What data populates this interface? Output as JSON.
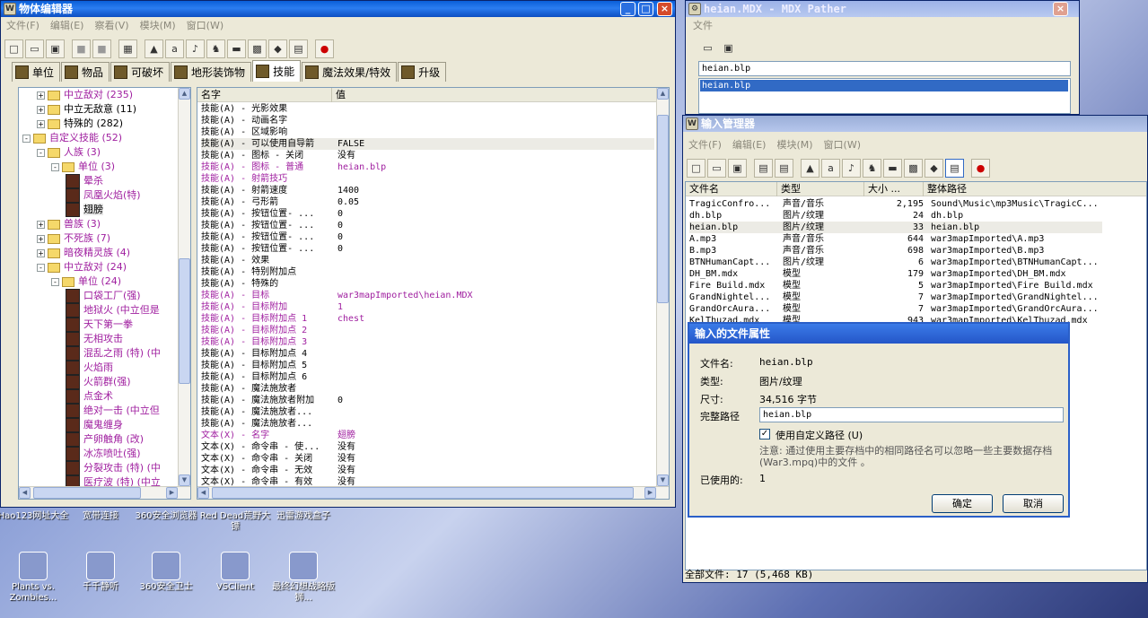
{
  "object_editor": {
    "title": "物体编辑器",
    "menu": [
      "文件(F)",
      "编辑(E)",
      "察看(V)",
      "模块(M)",
      "窗口(W)"
    ],
    "tabs": [
      "单位",
      "物品",
      "可破坏",
      "地形装饰物",
      "技能",
      "魔法效果/特效",
      "升级"
    ],
    "active_tab": "技能",
    "tree": [
      {
        "indent": 0,
        "exp": "+",
        "type": "folder",
        "label": "中立敌对 (235)",
        "purple": true
      },
      {
        "indent": 0,
        "exp": "+",
        "type": "folder",
        "label": "中立无敌意 (11)",
        "purple": false
      },
      {
        "indent": 0,
        "exp": "+",
        "type": "folder",
        "label": "特殊的 (282)",
        "purple": false
      },
      {
        "indent": -1,
        "exp": "-",
        "type": "folder",
        "label": "自定义技能 (52)",
        "purple": true
      },
      {
        "indent": 0,
        "exp": "-",
        "type": "folder",
        "label": "人族 (3)",
        "purple": true
      },
      {
        "indent": 1,
        "exp": "-",
        "type": "folder",
        "label": "单位 (3)",
        "purple": true
      },
      {
        "indent": 2,
        "exp": "",
        "type": "icon",
        "label": "晕杀",
        "purple": true
      },
      {
        "indent": 2,
        "exp": "",
        "type": "icon",
        "label": "凤凰火焰(特)",
        "purple": true
      },
      {
        "indent": 2,
        "exp": "",
        "type": "icon",
        "label": "翅膀",
        "purple": false,
        "selected": true
      },
      {
        "indent": 0,
        "exp": "+",
        "type": "folder",
        "label": "兽族 (3)",
        "purple": true
      },
      {
        "indent": 0,
        "exp": "+",
        "type": "folder",
        "label": "不死族 (7)",
        "purple": true
      },
      {
        "indent": 0,
        "exp": "+",
        "type": "folder",
        "label": "暗夜精灵族 (4)",
        "purple": true
      },
      {
        "indent": 0,
        "exp": "-",
        "type": "folder",
        "label": "中立敌对 (24)",
        "purple": true
      },
      {
        "indent": 1,
        "exp": "-",
        "type": "folder",
        "label": "单位 (24)",
        "purple": true
      },
      {
        "indent": 2,
        "exp": "",
        "type": "icon",
        "label": "口袋工厂(强)",
        "purple": true
      },
      {
        "indent": 2,
        "exp": "",
        "type": "icon",
        "label": "地狱火 (中立但是",
        "purple": true
      },
      {
        "indent": 2,
        "exp": "",
        "type": "icon",
        "label": "天下第一拳",
        "purple": true
      },
      {
        "indent": 2,
        "exp": "",
        "type": "icon",
        "label": "无相攻击",
        "purple": true
      },
      {
        "indent": 2,
        "exp": "",
        "type": "icon",
        "label": "混乱之雨 (特) (中",
        "purple": true
      },
      {
        "indent": 2,
        "exp": "",
        "type": "icon",
        "label": "火焰雨",
        "purple": true
      },
      {
        "indent": 2,
        "exp": "",
        "type": "icon",
        "label": "火箭群(强)",
        "purple": true
      },
      {
        "indent": 2,
        "exp": "",
        "type": "icon",
        "label": "点金术",
        "purple": true
      },
      {
        "indent": 2,
        "exp": "",
        "type": "icon",
        "label": "绝对一击 (中立但",
        "purple": true
      },
      {
        "indent": 2,
        "exp": "",
        "type": "icon",
        "label": "魔鬼缠身",
        "purple": true
      },
      {
        "indent": 2,
        "exp": "",
        "type": "icon",
        "label": "产卵触角 (改)",
        "purple": true
      },
      {
        "indent": 2,
        "exp": "",
        "type": "icon",
        "label": "冰冻喷吐(强)",
        "purple": true
      },
      {
        "indent": 2,
        "exp": "",
        "type": "icon",
        "label": "分裂攻击 (特) (中",
        "purple": true
      },
      {
        "indent": 2,
        "exp": "",
        "type": "icon",
        "label": "医疗波 (特) (中立",
        "purple": true
      }
    ],
    "prop_headers": [
      "名字",
      "值"
    ],
    "props": [
      {
        "name": "技能(A) - 光影效果",
        "value": "",
        "purple": false
      },
      {
        "name": "技能(A) - 动画名字",
        "value": "",
        "purple": false
      },
      {
        "name": "技能(A) - 区域影响",
        "value": "",
        "purple": false
      },
      {
        "name": "技能(A) - 可以使用自导箭",
        "value": "FALSE",
        "purple": false,
        "hl": true
      },
      {
        "name": "技能(A) - 图标 - 关闭",
        "value": "没有",
        "purple": false
      },
      {
        "name": "技能(A) - 图标 - 普通",
        "value": "heian.blp",
        "purple": true
      },
      {
        "name": "技能(A) - 射箭技巧",
        "value": "",
        "purple": true
      },
      {
        "name": "技能(A) - 射箭速度",
        "value": "1400",
        "purple": false
      },
      {
        "name": "技能(A) - 弓形箭",
        "value": "0.05",
        "purple": false
      },
      {
        "name": "技能(A) - 按钮位置- ...",
        "value": "0",
        "purple": false
      },
      {
        "name": "技能(A) - 按钮位置- ...",
        "value": "0",
        "purple": false
      },
      {
        "name": "技能(A) - 按钮位置- ...",
        "value": "0",
        "purple": false
      },
      {
        "name": "技能(A) - 按钮位置- ...",
        "value": "0",
        "purple": false
      },
      {
        "name": "技能(A) - 效果",
        "value": "",
        "purple": false
      },
      {
        "name": "技能(A) - 特别附加点",
        "value": "",
        "purple": false
      },
      {
        "name": "技能(A) - 特殊的",
        "value": "",
        "purple": false
      },
      {
        "name": "技能(A) - 目标",
        "value": "war3mapImported\\heian.MDX",
        "purple": true
      },
      {
        "name": "技能(A) - 目标附加",
        "value": "1",
        "purple": true
      },
      {
        "name": "技能(A) - 目标附加点 1",
        "value": "chest",
        "purple": true
      },
      {
        "name": "技能(A) - 目标附加点 2",
        "value": "",
        "purple": true
      },
      {
        "name": "技能(A) - 目标附加点 3",
        "value": "",
        "purple": true
      },
      {
        "name": "技能(A) - 目标附加点 4",
        "value": "",
        "purple": false
      },
      {
        "name": "技能(A) - 目标附加点 5",
        "value": "",
        "purple": false
      },
      {
        "name": "技能(A) - 目标附加点 6",
        "value": "",
        "purple": false
      },
      {
        "name": "技能(A) - 魔法施放者",
        "value": "",
        "purple": false
      },
      {
        "name": "技能(A) - 魔法施放者附加",
        "value": "0",
        "purple": false
      },
      {
        "name": "技能(A) - 魔法施放者...",
        "value": "",
        "purple": false
      },
      {
        "name": "技能(A) - 魔法施放者...",
        "value": "",
        "purple": false
      },
      {
        "name": "文本(X) - 名字",
        "value": "翅膀",
        "purple": true
      },
      {
        "name": "文本(X) - 命令串 - 使...",
        "value": "没有",
        "purple": false
      },
      {
        "name": "文本(X) - 命令串 - 关闭",
        "value": "没有",
        "purple": false
      },
      {
        "name": "文本(X) - 命令串 - 无效",
        "value": "没有",
        "purple": false
      },
      {
        "name": "文本(X) - 命令串 - 有效",
        "value": "没有",
        "purple": false
      }
    ]
  },
  "mdx_pather": {
    "title": "heian.MDX - MDX Pather",
    "menu": [
      "文件"
    ],
    "input_value": "heian.blp",
    "list_selected": "heian.blp"
  },
  "import_manager": {
    "title": "输入管理器",
    "menu": [
      "文件(F)",
      "编辑(E)",
      "模块(M)",
      "窗口(W)"
    ],
    "headers": [
      "文件名",
      "类型",
      "大小 ...",
      "整体路径"
    ],
    "files": [
      {
        "name": "TragicConfro...",
        "type": "声音/音乐",
        "size": "2,195",
        "path": "Sound\\Music\\mp3Music\\TragicC..."
      },
      {
        "name": "dh.blp",
        "type": "图片/纹理",
        "size": "24",
        "path": "dh.blp"
      },
      {
        "name": "heian.blp",
        "type": "图片/纹理",
        "size": "33",
        "path": "heian.blp",
        "hl": true
      },
      {
        "name": "A.mp3",
        "type": "声音/音乐",
        "size": "644",
        "path": "war3mapImported\\A.mp3"
      },
      {
        "name": "B.mp3",
        "type": "声音/音乐",
        "size": "698",
        "path": "war3mapImported\\B.mp3"
      },
      {
        "name": "BTNHumanCapt...",
        "type": "图片/纹理",
        "size": "6",
        "path": "war3mapImported\\BTNHumanCapt..."
      },
      {
        "name": "DH_BM.mdx",
        "type": "模型",
        "size": "179",
        "path": "war3mapImported\\DH_BM.mdx"
      },
      {
        "name": "Fire Build.mdx",
        "type": "模型",
        "size": "5",
        "path": "war3mapImported\\Fire Build.mdx"
      },
      {
        "name": "GrandNightel...",
        "type": "模型",
        "size": "7",
        "path": "war3mapImported\\GrandNightel..."
      },
      {
        "name": "GrandOrcAura...",
        "type": "模型",
        "size": "7",
        "path": "war3mapImported\\GrandOrcAura..."
      },
      {
        "name": "KelThuzad.mdx",
        "type": "模型",
        "size": "943",
        "path": "war3mapImported\\KelThuzad.mdx"
      }
    ],
    "status": "全部文件: 17 (5,468 KB)"
  },
  "props_dialog": {
    "title": "输入的文件属性",
    "filename_label": "文件名:",
    "filename": "heian.blp",
    "type_label": "类型:",
    "type": "图片/纹理",
    "size_label": "尺寸:",
    "size": "34,516 字节",
    "fullpath_label": "完整路径",
    "fullpath": "heian.blp",
    "use_custom_label": "使用自定义路径 (U)",
    "note": "注意: 通过使用主要存档中的相同路径名可以忽略一些主要数据存档(War3.mpq)中的文件 。",
    "used_label": "已使用的:",
    "used": "1",
    "ok": "确定",
    "cancel": "取消"
  },
  "desktop_icons": [
    {
      "label": "Hao123网址大全"
    },
    {
      "label": "宽带连接"
    },
    {
      "label": "360安全浏览器"
    },
    {
      "label": "Red Dead荒野大镖"
    },
    {
      "label": "迅雷游戏盒子"
    },
    {
      "label": "Plants vs. Zombies..."
    },
    {
      "label": "千千静听"
    },
    {
      "label": "360安全卫士"
    },
    {
      "label": "VSClient"
    },
    {
      "label": "最终幻想战略版狮..."
    }
  ]
}
